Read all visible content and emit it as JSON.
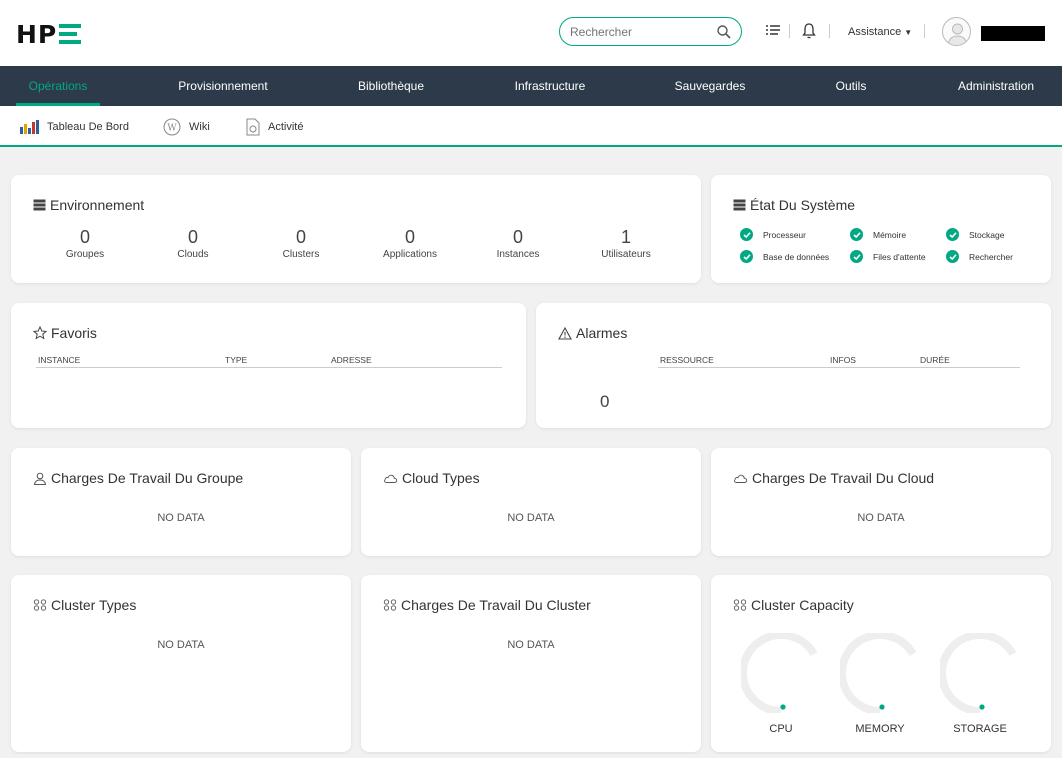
{
  "header": {
    "logo": "HP",
    "search_placeholder": "Rechercher",
    "assistance_label": "Assistance"
  },
  "nav": {
    "items": [
      {
        "label": "Opérations",
        "active": true
      },
      {
        "label": "Provisionnement"
      },
      {
        "label": "Bibliothèque"
      },
      {
        "label": "Infrastructure"
      },
      {
        "label": "Sauvegardes"
      },
      {
        "label": "Outils"
      },
      {
        "label": "Administration"
      }
    ]
  },
  "subnav": {
    "items": [
      {
        "label": "Tableau De Bord",
        "icon": "bar-chart-icon"
      },
      {
        "label": "Wiki",
        "icon": "wiki-icon"
      },
      {
        "label": "Activité",
        "icon": "activity-icon"
      }
    ]
  },
  "environment": {
    "title": "Environnement",
    "stats": [
      {
        "value": "0",
        "label": "Groupes"
      },
      {
        "value": "0",
        "label": "Clouds"
      },
      {
        "value": "0",
        "label": "Clusters"
      },
      {
        "value": "0",
        "label": "Applications"
      },
      {
        "value": "0",
        "label": "Instances"
      },
      {
        "value": "1",
        "label": "Utilisateurs"
      }
    ]
  },
  "system_state": {
    "title": "État Du Système",
    "items": [
      {
        "label": "Processeur",
        "status": "ok"
      },
      {
        "label": "Mémoire",
        "status": "ok"
      },
      {
        "label": "Stockage",
        "status": "ok"
      },
      {
        "label": "Base de données",
        "status": "ok"
      },
      {
        "label": "Files d'attente",
        "status": "ok"
      },
      {
        "label": "Rechercher",
        "status": "ok"
      }
    ]
  },
  "favorites": {
    "title": "Favoris",
    "columns": [
      "INSTANCE",
      "TYPE",
      "ADRESSE"
    ]
  },
  "alarms": {
    "title": "Alarmes",
    "columns": [
      "RESSOURCE",
      "INFOS",
      "DURÉE"
    ],
    "count": "0"
  },
  "widgets": {
    "group_workloads": {
      "title": "Charges De Travail Du Groupe",
      "empty": "NO DATA"
    },
    "cloud_types": {
      "title": "Cloud Types",
      "empty": "NO DATA"
    },
    "cloud_workloads": {
      "title": "Charges De Travail Du Cloud",
      "empty": "NO DATA"
    },
    "cluster_types": {
      "title": "Cluster Types",
      "empty": "NO DATA"
    },
    "cluster_workloads": {
      "title": "Charges De Travail Du Cluster",
      "empty": "NO DATA"
    },
    "cluster_capacity": {
      "title": "Cluster Capacity",
      "gauges": [
        {
          "label": "CPU",
          "value": 0
        },
        {
          "label": "MEMORY",
          "value": 0
        },
        {
          "label": "STORAGE",
          "value": 0
        }
      ]
    }
  },
  "colors": {
    "accent": "#01a982",
    "nav_bg": "#2d3a4a",
    "page_bg": "#f1f1f1"
  }
}
